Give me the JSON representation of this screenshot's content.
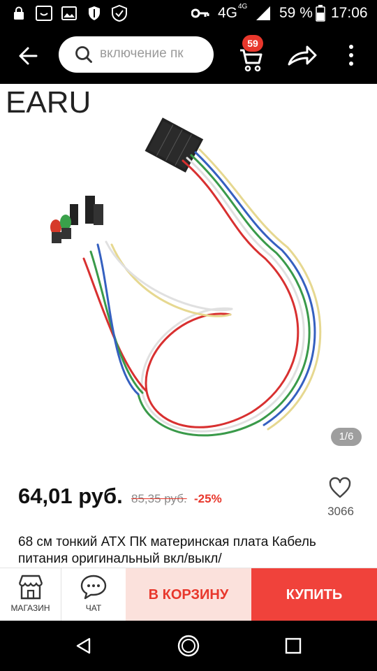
{
  "status_bar": {
    "network": "4G",
    "network_small": "4G",
    "battery": "59 %",
    "time": "17:06",
    "icons": [
      "lock-icon",
      "face-icon",
      "image-icon",
      "shield-icon",
      "vpn-shield-icon",
      "key-icon",
      "signal-icon",
      "battery-icon"
    ]
  },
  "top_bar": {
    "search_text": "включение пк",
    "cart_count": "59",
    "icons": [
      "back-arrow-icon",
      "search-icon",
      "cart-icon",
      "share-icon",
      "more-vertical-icon"
    ]
  },
  "image": {
    "brand": "EARU",
    "counter": "1/6"
  },
  "product": {
    "price": "64,01 руб.",
    "old_price": "85,35 руб.",
    "discount": "-25%",
    "wishlist_count": "3066",
    "title": "68 см тонкий ATX ПК материнская плата Кабель питания оригинальный вкл/выкл/"
  },
  "actions": {
    "store_label": "МАГАЗИН",
    "chat_label": "ЧАТ",
    "add_to_cart": "В КОРЗИНУ",
    "buy": "КУПИТЬ"
  },
  "colors": {
    "accent": "#e8372c",
    "buy_button": "#f0423b",
    "cart_button_bg": "#fbe1dc",
    "bar_bg": "#000000"
  }
}
